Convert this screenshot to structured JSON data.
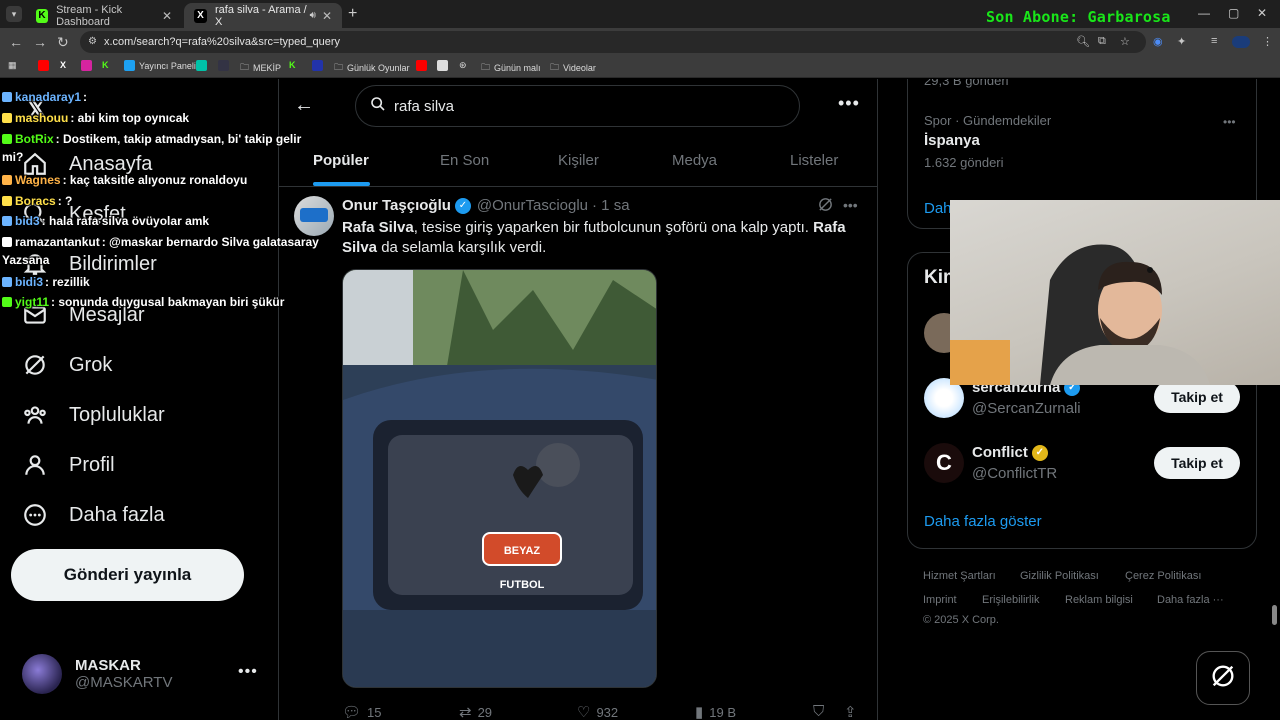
{
  "browser": {
    "tabs": [
      {
        "label": "Stream - Kick Dashboard",
        "favicon": "kick-icon",
        "active": false
      },
      {
        "label": "rafa silva - Arama / X",
        "favicon": "x-icon",
        "active": true
      }
    ],
    "overlay_banner": "Son Abone: Garbarosa",
    "url": "x.com/search?q=rafa%20silva&src=typed_query",
    "bookmarks": [
      "Yayıncı Paneli",
      "MEKİP",
      "Günlük Oyunlar",
      "Günün malı",
      "Videolar"
    ]
  },
  "colors": {
    "accent": "#1d9bf0",
    "overlay_green": "#19e619",
    "kick_green": "#53fc18"
  },
  "chat": [
    {
      "user": "kanadaray1",
      "message": ":",
      "color": "#6cb4ff"
    },
    {
      "user": "mashouu",
      "message": ": abi kim top oynıcak",
      "color": "#ffe04a"
    },
    {
      "user": "BotRix",
      "message": ": Dostikem, takip atmadıysan, bi' takip gelir",
      "color": "#53fc18"
    },
    {
      "user": "",
      "message": "mi?",
      "color": "#ffffff"
    },
    {
      "user": "Wagnes",
      "message": ": kaç taksitle alıyonuz ronaldoyu",
      "color": "#ffb347"
    },
    {
      "user": "Boracs",
      "message": ": ?",
      "color": "#ffe04a"
    },
    {
      "user": "bid3",
      "message": ": hala rafa silva övüyolar amk",
      "color": "#6cb4ff"
    },
    {
      "user": "ramazantankut",
      "message": ": @maskar bernardo Silva galatasaray",
      "color": "#ffffff"
    },
    {
      "user": "",
      "message": "Yazsana",
      "color": "#ffffff"
    },
    {
      "user": "bidi3",
      "message": ": rezillik",
      "color": "#6cb4ff"
    },
    {
      "user": "yigt11",
      "message": ": sonunda duygusal bakmayan biri şükür",
      "color": "#53fc18"
    }
  ],
  "nav": {
    "items": [
      {
        "label": "Anasayfa",
        "icon": "home-icon"
      },
      {
        "label": "Keşfet",
        "icon": "search-icon"
      },
      {
        "label": "Bildirimler",
        "icon": "bell-icon"
      },
      {
        "label": "Mesajlar",
        "icon": "mail-icon"
      },
      {
        "label": "Grok",
        "icon": "grok-icon"
      },
      {
        "label": "Topluluklar",
        "icon": "communities-icon"
      },
      {
        "label": "Profil",
        "icon": "profile-icon"
      },
      {
        "label": "Daha fazla",
        "icon": "more-circle-icon"
      }
    ],
    "post_button": "Gönderi yayınla",
    "profile": {
      "name": "MASKAR",
      "handle": "@MASKARTV"
    }
  },
  "search": {
    "query": "rafa silva",
    "tabs": [
      "Popüler",
      "En Son",
      "Kişiler",
      "Medya",
      "Listeler"
    ],
    "active_tab": "Popüler"
  },
  "tweet": {
    "author": "Onur Taşçıoğlu",
    "handle": "@OnurTascioglu",
    "time": "· 1 sa",
    "text_bold_1": "Rafa Silva",
    "text_1": ", tesise giriş yaparken bir futbolcunun şoförü ona kalp yaptı. ",
    "text_bold_2": "Rafa Silva",
    "text_2": " da selamla karşılık verdi.",
    "media_watermark": "BEYAZ FUTBOL",
    "stats": {
      "replies": "15",
      "reposts": "29",
      "likes": "932",
      "views": "19 B"
    }
  },
  "right": {
    "trend_top": "29,3 B gönderi",
    "trend": {
      "category": "Spor · Gündemdekiler",
      "name": "İspanya",
      "count": "1.632 gönderi"
    },
    "trend_more": "Daha",
    "who_title": "Kim",
    "who": [
      {
        "name": "sercanzurna",
        "handle": "@SercanZurnali",
        "follow": "Takip et"
      },
      {
        "name": "Conflict",
        "handle": "@ConflictTR",
        "follow": "Takip et"
      }
    ],
    "show_more": "Daha fazla göster",
    "footer": [
      "Hizmet Şartları",
      "Gizlilik Politikası",
      "Çerez Politikası",
      "Imprint",
      "Erişilebilirlik",
      "Reklam bilgisi",
      "Daha fazla ···",
      "© 2025 X Corp."
    ]
  }
}
